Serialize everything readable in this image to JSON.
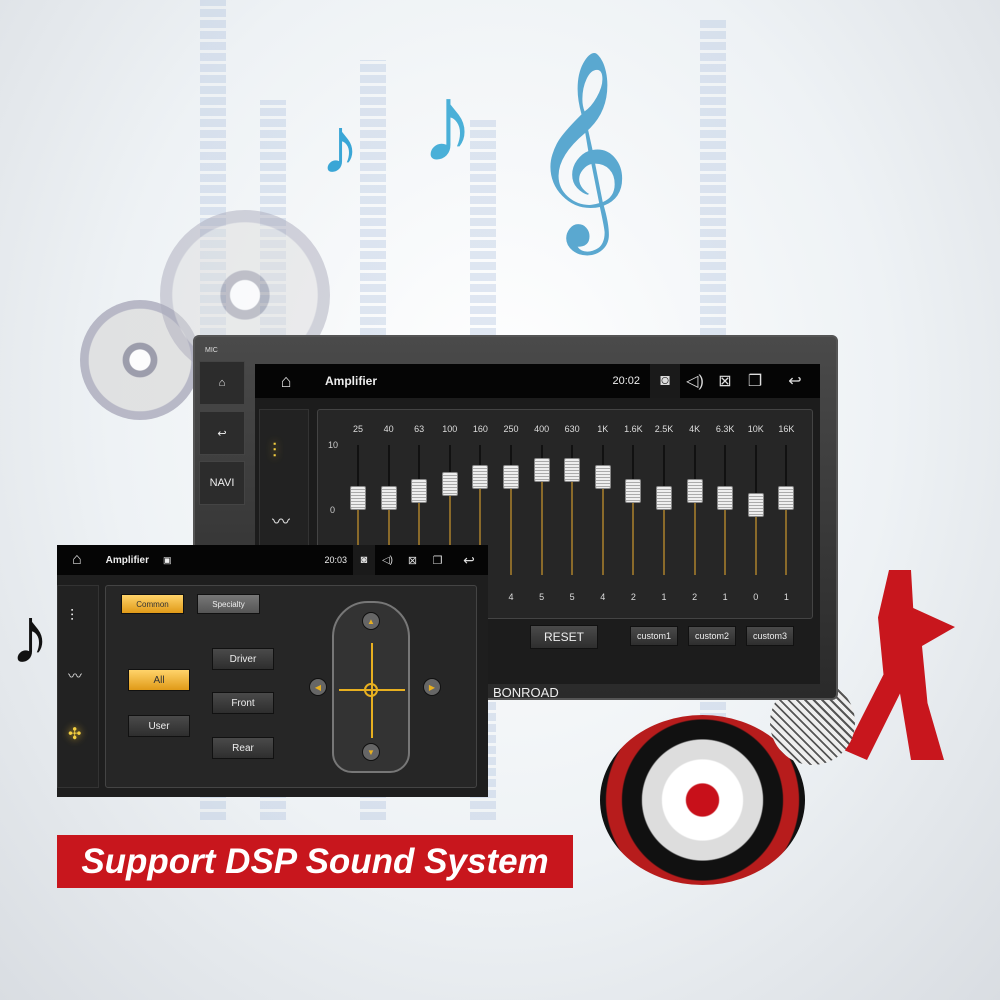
{
  "main_screen": {
    "side_buttons": {
      "mic": "MIC",
      "navi": "NAVI"
    },
    "title": "Amplifier",
    "time": "20:02",
    "eq": {
      "y_ticks": [
        "10",
        "0"
      ],
      "bands": [
        {
          "freq": "25",
          "level": 1,
          "value": null
        },
        {
          "freq": "40",
          "level": 1,
          "value": null
        },
        {
          "freq": "63",
          "level": 2,
          "value": null
        },
        {
          "freq": "100",
          "level": 3,
          "value": null
        },
        {
          "freq": "160",
          "level": 4,
          "value": null
        },
        {
          "freq": "250",
          "level": 4,
          "value": "4"
        },
        {
          "freq": "400",
          "level": 5,
          "value": "5"
        },
        {
          "freq": "630",
          "level": 5,
          "value": "5"
        },
        {
          "freq": "1K",
          "level": 4,
          "value": "4"
        },
        {
          "freq": "1.6K",
          "level": 2,
          "value": "2"
        },
        {
          "freq": "2.5K",
          "level": 1,
          "value": "1"
        },
        {
          "freq": "4K",
          "level": 2,
          "value": "2"
        },
        {
          "freq": "6.3K",
          "level": 1,
          "value": "1"
        },
        {
          "freq": "10K",
          "level": 0,
          "value": "0"
        },
        {
          "freq": "16K",
          "level": 1,
          "value": "1"
        }
      ]
    },
    "reset": "RESET",
    "custom": [
      "custom1",
      "custom2",
      "custom3"
    ],
    "brand": "BONROAD"
  },
  "small_screen": {
    "title": "Amplifier",
    "time": "20:03",
    "tabs": [
      "Common",
      "Specialty"
    ],
    "modes": [
      "All",
      "User"
    ],
    "zones": [
      "Driver",
      "Front",
      "Rear"
    ]
  },
  "banner": "Support DSP Sound System",
  "colors": {
    "accent": "#f0b030",
    "banner": "#c8161d"
  }
}
